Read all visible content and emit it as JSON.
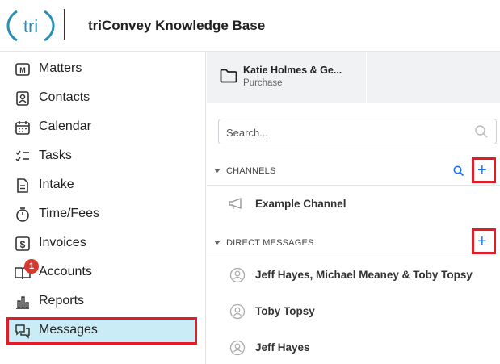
{
  "header": {
    "logo_text": "tri",
    "title": "triConvey Knowledge Base"
  },
  "sidebar": {
    "items": [
      {
        "label": "Matters",
        "icon": "matters-icon"
      },
      {
        "label": "Contacts",
        "icon": "contacts-icon"
      },
      {
        "label": "Calendar",
        "icon": "calendar-icon"
      },
      {
        "label": "Tasks",
        "icon": "tasks-icon"
      },
      {
        "label": "Intake",
        "icon": "intake-icon"
      },
      {
        "label": "Time/Fees",
        "icon": "stopwatch-icon"
      },
      {
        "label": "Invoices",
        "icon": "invoice-dollar-icon"
      },
      {
        "label": "Accounts",
        "icon": "accounts-book-icon",
        "badge": "1"
      },
      {
        "label": "Reports",
        "icon": "bar-chart-icon"
      },
      {
        "label": "Messages",
        "icon": "chat-bubbles-icon",
        "active": true
      }
    ]
  },
  "matter_tab": {
    "title": "Katie Holmes & Ge...",
    "subtitle": "Purchase"
  },
  "search": {
    "placeholder": "Search..."
  },
  "channels": {
    "title": "CHANNELS",
    "items": [
      "Example Channel"
    ]
  },
  "direct_messages": {
    "title": "DIRECT MESSAGES",
    "items": [
      "Jeff Hayes, Michael Meaney & Toby Topsy",
      "Toby Topsy",
      "Jeff Hayes"
    ]
  },
  "colors": {
    "accent_blue": "#1a73e8",
    "active_bg": "#c9ecf6",
    "highlight_red": "#e01c24",
    "badge_red": "#d63a2f"
  }
}
